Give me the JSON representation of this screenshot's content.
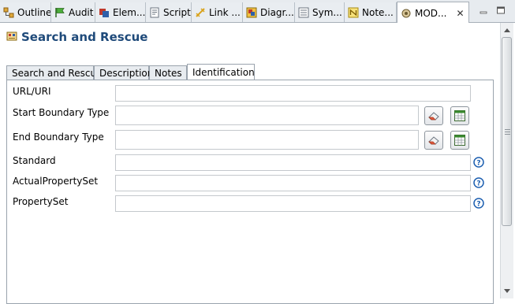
{
  "view_tabs": [
    {
      "label": "Outline",
      "icon": "outline-icon"
    },
    {
      "label": "Audit",
      "icon": "flag-icon"
    },
    {
      "label": "Elem...",
      "icon": "element-icon"
    },
    {
      "label": "Script",
      "icon": "script-icon"
    },
    {
      "label": "Link ...",
      "icon": "link-icon"
    },
    {
      "label": "Diagr...",
      "icon": "diagram-icon"
    },
    {
      "label": "Sym...",
      "icon": "symbol-icon"
    },
    {
      "label": "Note...",
      "icon": "note-icon"
    },
    {
      "label": "MOD...",
      "icon": "model-icon",
      "active": true
    }
  ],
  "form": {
    "title": "Search and Rescue"
  },
  "inner_tabs": [
    {
      "label": "Search and Rescue"
    },
    {
      "label": "Description"
    },
    {
      "label": "Notes"
    },
    {
      "label": "Identification",
      "active": true
    }
  ],
  "fields": [
    {
      "label": "URL/URI",
      "value": ""
    },
    {
      "label": "Start Boundary Type",
      "value": ""
    },
    {
      "label": "End Boundary Type",
      "value": ""
    },
    {
      "label": "Standard",
      "value": ""
    },
    {
      "label": "ActualPropertySet",
      "value": ""
    },
    {
      "label": "PropertySet",
      "value": ""
    }
  ],
  "colors": {
    "title": "#1f4a7a",
    "help": "#1d5fb0",
    "accent_green": "#3a8a2f"
  }
}
